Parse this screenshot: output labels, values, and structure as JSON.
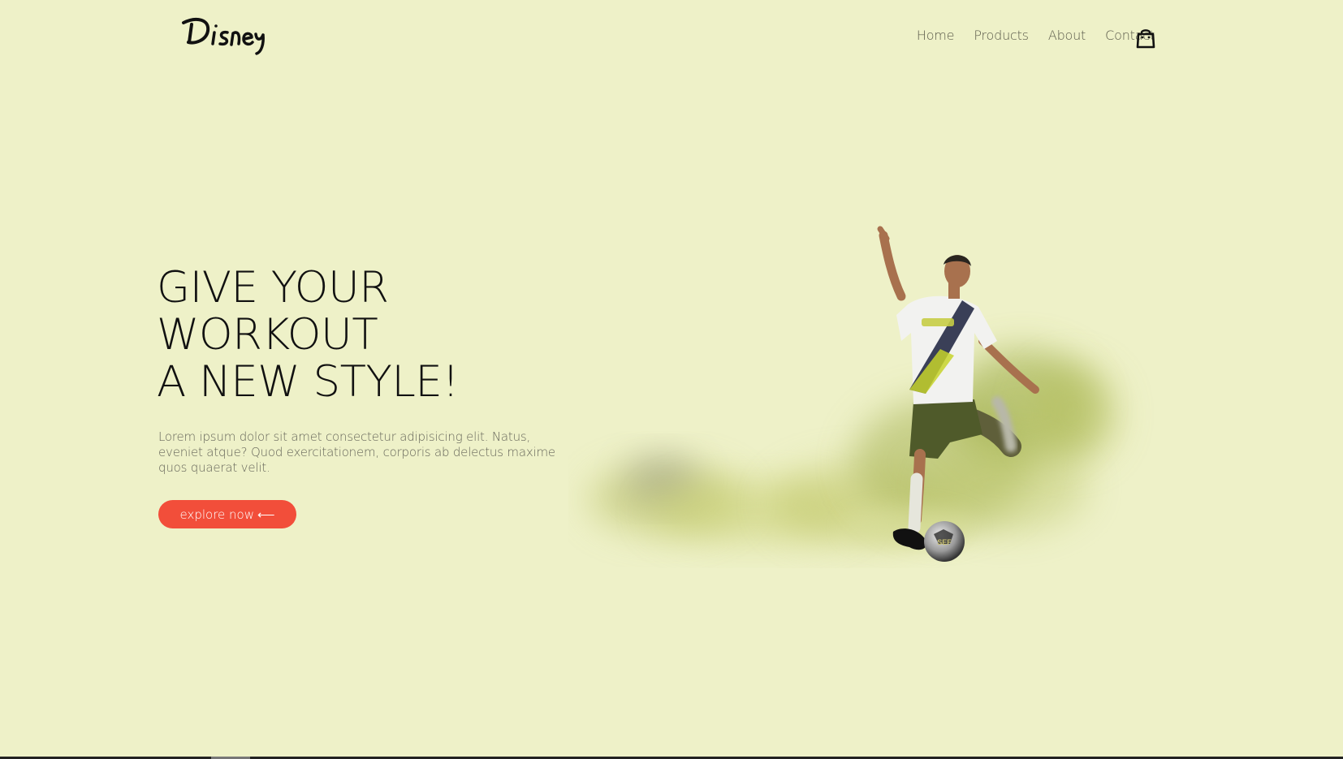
{
  "header": {
    "logo_text": "Disney",
    "nav": [
      "Home",
      "Products",
      "About",
      "Contact"
    ],
    "cart_icon": "shopping-bag-icon"
  },
  "hero": {
    "title_lines": [
      "GIVE YOUR",
      "WORKOUT",
      "A NEW STYLE!"
    ],
    "description": "Lorem ipsum dolor sit amet consectetur adipisicing elit. Natus, eveniet atque? Quod exercitationem, corporis ab delectus maxime quos quaerat velit.",
    "cta_label": "explore now",
    "cta_icon": "arrow-left-icon",
    "image_alt": "soccer-player-kicking-ball",
    "ball_text": "SEF"
  },
  "colors": {
    "background": "#eef1c8",
    "accent": "#f24e3a",
    "text": "#111111",
    "muted": "#66665a"
  }
}
